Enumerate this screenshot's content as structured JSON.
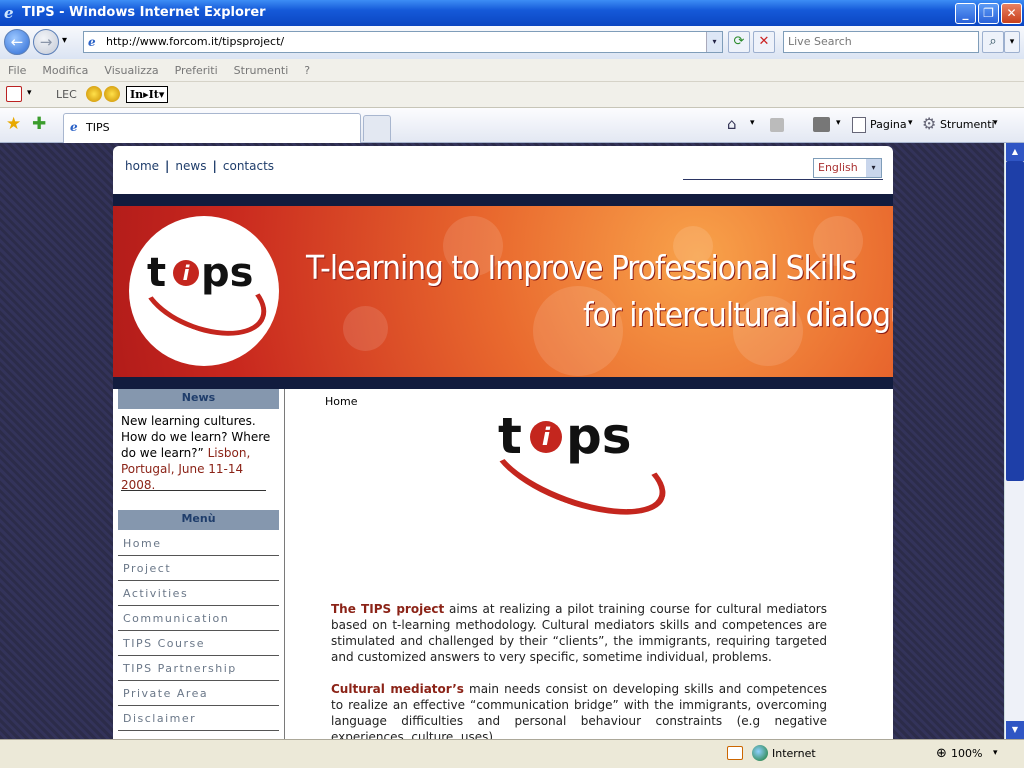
{
  "window": {
    "title": "TIPS - Windows Internet Explorer",
    "ie_glyph": "e"
  },
  "controls": {
    "minimize": "_",
    "maximize": "❐",
    "close": "✕"
  },
  "nav": {
    "back_glyph": "←",
    "forward_glyph": "→",
    "dropdown_glyph": "▾",
    "address": "http://www.forcom.it/tipsproject/",
    "refresh_glyph": "⟳",
    "stop_glyph": "✕",
    "search_placeholder": "Live Search",
    "search_glyph": "⌕"
  },
  "menubar": [
    "File",
    "Modifica",
    "Visualizza",
    "Preferiti",
    "Strumenti",
    "?"
  ],
  "linksbar": {
    "lec": "LEC",
    "init": "In▸It▾"
  },
  "tab": {
    "title": "TIPS"
  },
  "commands": {
    "page": "Pagina",
    "tools": "Strumenti"
  },
  "site": {
    "topnav": [
      "home",
      "news",
      "contacts"
    ],
    "language": "English",
    "banner_line1": "T-learning to Improve Professional Skills",
    "banner_line2": "for intercultural dialogue",
    "logo": {
      "t": "t",
      "i": "i",
      "ps": "ps"
    },
    "news_heading": "News",
    "news_text": "New learning cultures. How do we learn? Where do we learn?”",
    "news_place": "Lisbon, Portugal, June 11-14 2008.",
    "menu_heading": "Menù",
    "menu_items": [
      "Home",
      "Project",
      "Activities",
      "Communication",
      "TIPS Course",
      "TIPS Partnership",
      "Private Area",
      "Disclaimer"
    ],
    "breadcrumb": "Home",
    "para1_bold": "The TIPS project",
    "para1_text": " aims at realizing a pilot training course for cultural mediators based on t-learning methodology. Cultural mediators skills and competences are stimulated and challenged by their “clients”, the immigrants, requiring targeted and customized answers to very specific, sometime individual, problems.",
    "para2_bold": "Cultural mediator’s",
    "para2_text": " main needs consist on developing skills and competences to realize an effective “communication bridge” with the immigrants, overcoming language difficulties and personal behaviour constraints (e.g negative experiences, culture, uses)."
  },
  "status": {
    "zone": "Internet",
    "zoom": "100%"
  },
  "colors": {
    "accent_red": "#8b2317",
    "nav_blue": "#1f3d6b",
    "band": "#121c3e"
  }
}
